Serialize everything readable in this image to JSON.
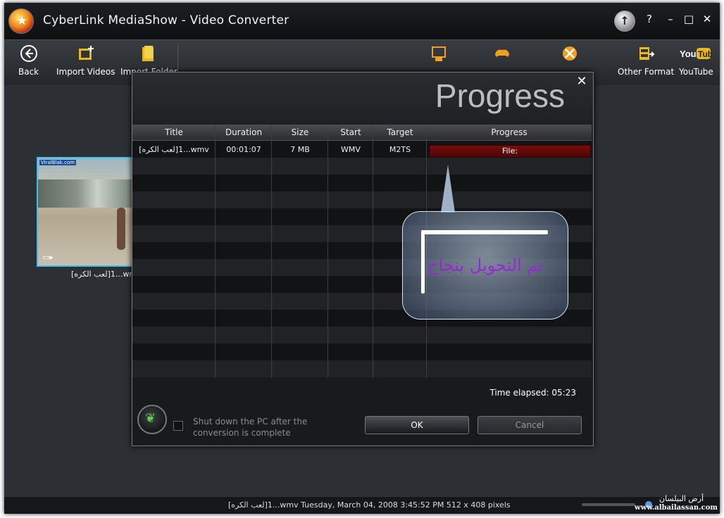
{
  "window": {
    "title": "CyberLink MediaShow - Video Converter",
    "upgrade_icon": "arrow-up-icon",
    "help": "?",
    "minimize": "–",
    "maximize": "□",
    "close": "✕"
  },
  "toolbar": {
    "back": "Back",
    "import_videos": "Import Videos",
    "import_folder": "Import Folder",
    "other_format": "Other Format",
    "youtube": "YouTube"
  },
  "media": {
    "thumb_tag": "ViralBlak.com",
    "caption": "[لعب الكره]1...wmv"
  },
  "dialog": {
    "title": "Progress",
    "close": "✕",
    "columns": [
      "Title",
      "Duration",
      "Size",
      "Start",
      "Target",
      "Progress"
    ],
    "rows": [
      {
        "title": "[لعب الكره]1...wmv",
        "duration": "00:01:07",
        "size": "7 MB",
        "start": "WMV",
        "target": "M2TS",
        "progress": "File:"
      }
    ],
    "progress_fraction": 1.0,
    "elapsed": "Time elapsed: 05:23",
    "shutdown_label": "Shut down the PC after the conversion is complete",
    "shutdown_checked": false,
    "ok": "OK",
    "cancel": "Cancel"
  },
  "callout": {
    "text": "تم التحويل بنجاح"
  },
  "status": {
    "text": "[لعب الكره]1...wmv  Tuesday, March 04, 2008 3:45:52 PM  512 x 408 pixels"
  },
  "watermark": {
    "arabic": "أرض البيلسان",
    "url": "www.albailassan.com"
  },
  "colors": {
    "accent": "#3fc0f0",
    "progress": "#7a0c0c",
    "callout_text": "#9a27d0"
  }
}
